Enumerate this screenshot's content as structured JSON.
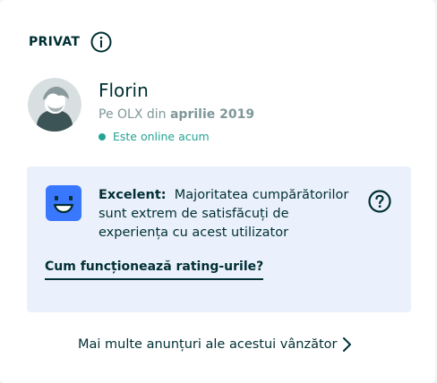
{
  "header": {
    "account_type": "PRIVAT",
    "info_icon": "info-icon"
  },
  "seller": {
    "name": "Florin",
    "since_prefix": "Pe OLX din",
    "since_date": "aprilie 2019",
    "online_status": "Este online acum",
    "avatar": "user-avatar"
  },
  "rating": {
    "icon": "smiley-face-icon",
    "label": "Excelent:",
    "description": "Majoritatea cumpărătorilor sunt extrem de satisfăcuți de experiența cu acest utilizator",
    "help_icon": "question-circle-icon",
    "how_link": "Cum funcționează rating-urile?"
  },
  "footer": {
    "more_ads_link": "Mai multe anunțuri ale acestui vânzător",
    "chevron_icon": "chevron-right-icon"
  },
  "colors": {
    "text_primary": "#002f34",
    "text_muted": "#7f9799",
    "online_green": "#23a392",
    "rating_bg": "#ebf1fc",
    "smiley_blue": "#3a77ff"
  }
}
